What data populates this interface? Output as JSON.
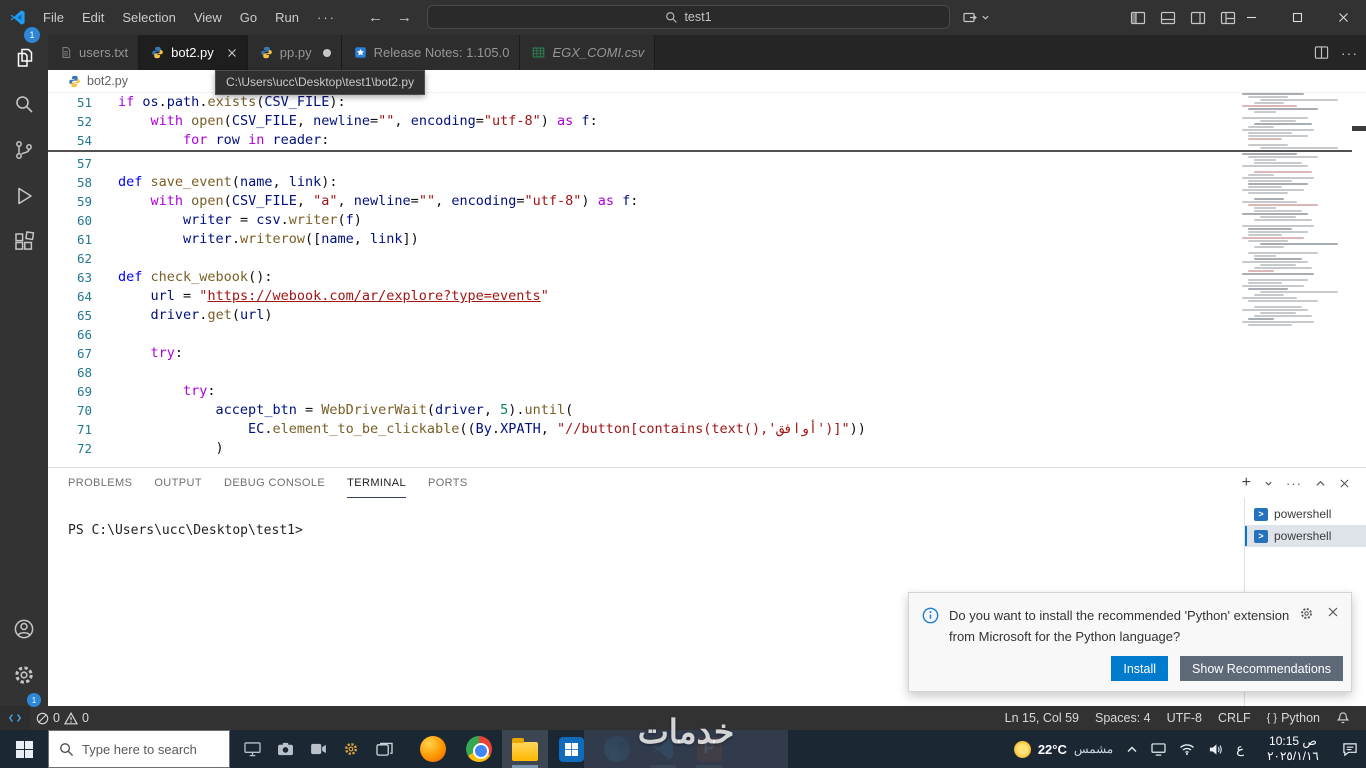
{
  "title_bar": {
    "menus": [
      "File",
      "Edit",
      "Selection",
      "View",
      "Go",
      "Run"
    ],
    "search_value": "test1"
  },
  "explorer_badge": "1",
  "settings_badge": "1",
  "tabs": [
    {
      "label": "users.txt",
      "icon": "file",
      "active": false,
      "modified": false,
      "preview": false
    },
    {
      "label": "bot2.py",
      "icon": "python",
      "active": true,
      "modified": false,
      "preview": false
    },
    {
      "label": "pp.py",
      "icon": "python",
      "active": false,
      "modified": true,
      "preview": false
    },
    {
      "label": "Release Notes: 1.105.0",
      "icon": "notes",
      "active": false,
      "modified": false,
      "preview": false
    },
    {
      "label": "EGX_COMI.csv",
      "icon": "csv",
      "active": false,
      "modified": false,
      "preview": true
    }
  ],
  "breadcrumb": {
    "file": "bot2.py"
  },
  "path_tooltip": "C:\\Users\\ucc\\Desktop\\test1\\bot2.py",
  "editor": {
    "sticky_lines": [
      {
        "n": 51,
        "t": [
          [
            "if ",
            "k"
          ],
          [
            "os",
            "v"
          ],
          [
            ".",
            "p"
          ],
          [
            "path",
            "v"
          ],
          [
            ".",
            "p"
          ],
          [
            "exists",
            "f"
          ],
          [
            "(",
            "p"
          ],
          [
            "CSV_FILE",
            "v"
          ],
          [
            "):",
            "p"
          ]
        ]
      },
      {
        "n": 52,
        "t": [
          [
            "    ",
            "p"
          ],
          [
            "with ",
            "k"
          ],
          [
            "open",
            "f"
          ],
          [
            "(",
            "p"
          ],
          [
            "CSV_FILE",
            "v"
          ],
          [
            ", ",
            "p"
          ],
          [
            "newline",
            "v"
          ],
          [
            "=",
            "p"
          ],
          [
            "\"\"",
            "s"
          ],
          [
            ", ",
            "p"
          ],
          [
            "encoding",
            "v"
          ],
          [
            "=",
            "p"
          ],
          [
            "\"utf-8\"",
            "s"
          ],
          [
            ") ",
            "p"
          ],
          [
            "as",
            "k"
          ],
          [
            " f",
            "v"
          ],
          [
            ":",
            "p"
          ]
        ]
      },
      {
        "n": 54,
        "t": [
          [
            "        ",
            "p"
          ],
          [
            "for ",
            "k"
          ],
          [
            "row",
            "v"
          ],
          [
            " in ",
            "k"
          ],
          [
            "reader",
            "v"
          ],
          [
            ":",
            "p"
          ]
        ]
      }
    ],
    "lines": [
      {
        "n": 57,
        "t": []
      },
      {
        "n": 58,
        "t": [
          [
            "def ",
            "d"
          ],
          [
            "save_event",
            "f"
          ],
          [
            "(",
            "p"
          ],
          [
            "name",
            "v"
          ],
          [
            ", ",
            "p"
          ],
          [
            "link",
            "v"
          ],
          [
            "):",
            "p"
          ]
        ]
      },
      {
        "n": 59,
        "t": [
          [
            "    ",
            "p"
          ],
          [
            "with ",
            "k"
          ],
          [
            "open",
            "f"
          ],
          [
            "(",
            "p"
          ],
          [
            "CSV_FILE",
            "v"
          ],
          [
            ", ",
            "p"
          ],
          [
            "\"a\"",
            "s"
          ],
          [
            ", ",
            "p"
          ],
          [
            "newline",
            "v"
          ],
          [
            "=",
            "p"
          ],
          [
            "\"\"",
            "s"
          ],
          [
            ", ",
            "p"
          ],
          [
            "encoding",
            "v"
          ],
          [
            "=",
            "p"
          ],
          [
            "\"utf-8\"",
            "s"
          ],
          [
            ") ",
            "p"
          ],
          [
            "as",
            "k"
          ],
          [
            " f",
            "v"
          ],
          [
            ":",
            "p"
          ]
        ]
      },
      {
        "n": 60,
        "t": [
          [
            "        ",
            "p"
          ],
          [
            "writer",
            "v"
          ],
          [
            " = ",
            "p"
          ],
          [
            "csv",
            "v"
          ],
          [
            ".",
            "p"
          ],
          [
            "writer",
            "f"
          ],
          [
            "(",
            "p"
          ],
          [
            "f",
            "v"
          ],
          [
            ")",
            "p"
          ]
        ]
      },
      {
        "n": 61,
        "t": [
          [
            "        ",
            "p"
          ],
          [
            "writer",
            "v"
          ],
          [
            ".",
            "p"
          ],
          [
            "writerow",
            "f"
          ],
          [
            "([",
            "p"
          ],
          [
            "name",
            "v"
          ],
          [
            ", ",
            "p"
          ],
          [
            "link",
            "v"
          ],
          [
            "])",
            "p"
          ]
        ]
      },
      {
        "n": 62,
        "t": []
      },
      {
        "n": 63,
        "t": [
          [
            "def ",
            "d"
          ],
          [
            "check_webook",
            "f"
          ],
          [
            "():",
            "p"
          ]
        ]
      },
      {
        "n": 64,
        "t": [
          [
            "    ",
            "p"
          ],
          [
            "url",
            "v"
          ],
          [
            " = ",
            "p"
          ],
          [
            "\"",
            "s"
          ],
          [
            "https://webook.com/ar/explore?type=events",
            "u"
          ],
          [
            "\"",
            "s"
          ]
        ]
      },
      {
        "n": 65,
        "t": [
          [
            "    ",
            "p"
          ],
          [
            "driver",
            "v"
          ],
          [
            ".",
            "p"
          ],
          [
            "get",
            "f"
          ],
          [
            "(",
            "p"
          ],
          [
            "url",
            "v"
          ],
          [
            ")",
            "p"
          ]
        ]
      },
      {
        "n": 66,
        "t": []
      },
      {
        "n": 67,
        "t": [
          [
            "    ",
            "p"
          ],
          [
            "try",
            "k"
          ],
          [
            ":",
            "p"
          ]
        ]
      },
      {
        "n": 68,
        "t": []
      },
      {
        "n": 69,
        "t": [
          [
            "        ",
            "p"
          ],
          [
            "try",
            "k"
          ],
          [
            ":",
            "p"
          ]
        ]
      },
      {
        "n": 70,
        "t": [
          [
            "            ",
            "p"
          ],
          [
            "accept_btn",
            "v"
          ],
          [
            " = ",
            "p"
          ],
          [
            "WebDriverWait",
            "f"
          ],
          [
            "(",
            "p"
          ],
          [
            "driver",
            "v"
          ],
          [
            ", ",
            "p"
          ],
          [
            "5",
            "n"
          ],
          [
            ").",
            "p"
          ],
          [
            "until",
            "f"
          ],
          [
            "(",
            "p"
          ]
        ]
      },
      {
        "n": 71,
        "t": [
          [
            "                ",
            "p"
          ],
          [
            "EC",
            "v"
          ],
          [
            ".",
            "p"
          ],
          [
            "element_to_be_clickable",
            "f"
          ],
          [
            "((",
            "p"
          ],
          [
            "By",
            "v"
          ],
          [
            ".",
            "p"
          ],
          [
            "XPATH",
            "v"
          ],
          [
            ", ",
            "p"
          ],
          [
            "\"//button[contains(text(),'أوافق')]\"",
            "s"
          ],
          [
            "))",
            "p"
          ]
        ]
      },
      {
        "n": 72,
        "t": [
          [
            "            ",
            "p"
          ],
          [
            ")",
            "p"
          ]
        ]
      }
    ]
  },
  "panel": {
    "tabs": [
      "PROBLEMS",
      "OUTPUT",
      "DEBUG CONSOLE",
      "TERMINAL",
      "PORTS"
    ],
    "active_tab": "TERMINAL",
    "terminal_prompt": "PS C:\\Users\\ucc\\Desktop\\test1>",
    "terminal_list": [
      {
        "label": "powershell",
        "selected": false
      },
      {
        "label": "powershell",
        "selected": true
      }
    ]
  },
  "notification": {
    "message": "Do you want to install the recommended 'Python' extension from Microsoft for the Python language?",
    "install_label": "Install",
    "show_recommendations_label": "Show Recommendations"
  },
  "status_bar": {
    "errors": "0",
    "warnings": "0",
    "cursor": "Ln 15, Col 59",
    "indent": "Spaces: 4",
    "encoding": "UTF-8",
    "eol": "CRLF",
    "language": "Python"
  },
  "taskbar": {
    "search_placeholder": "Type here to search",
    "weather_temp": "22°C",
    "weather_desc": "مشمس",
    "language_indicator": "ع",
    "clock_time": "10:15 ص",
    "clock_date": "٢٠٢٥/١/١٦"
  },
  "watermark": "خدمات"
}
